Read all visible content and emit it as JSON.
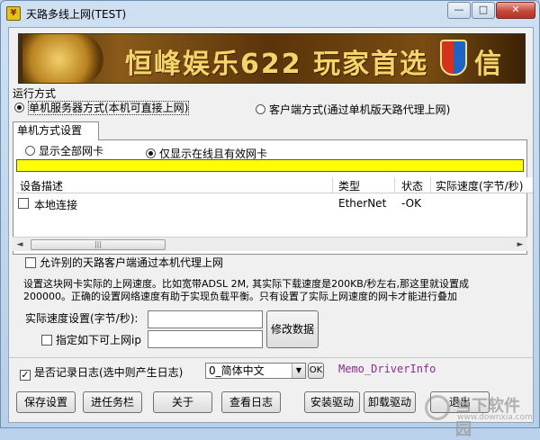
{
  "window": {
    "title": "天路多线上网(TEST)",
    "controls": {
      "minimize": "—",
      "maximize": "□",
      "close": "✕"
    }
  },
  "banner": {
    "text": "恒峰娱乐622 玩家首选",
    "text_right": "信誉"
  },
  "run_mode": {
    "label": "运行方式",
    "options": [
      {
        "label": "单机服务器方式(本机可直接上网)",
        "selected": true
      },
      {
        "label": "客户端方式(通过单机版天路代理上网)",
        "selected": false
      }
    ]
  },
  "tab": {
    "label": "单机方式设置"
  },
  "nic_filter": {
    "options": [
      {
        "label": "显示全部网卡",
        "selected": false
      },
      {
        "label": "仅显示在线且有效网卡",
        "selected": true
      }
    ]
  },
  "table": {
    "columns": [
      "设备描述",
      "类型",
      "状态",
      "实际速度(字节/秒)"
    ],
    "rows": [
      {
        "name": "本地连接",
        "type": "EtherNet",
        "status": "-OK",
        "speed": "",
        "checked": false
      }
    ]
  },
  "scrollbar": {
    "left": "◄",
    "right": "►",
    "grip": "|||"
  },
  "allow_proxy": {
    "label": "允许别的天路客户端通过本机代理上网",
    "checked": false
  },
  "notes": {
    "line1": "设置这块网卡实际的上网速度。比如宽带ADSL 2M, 其实际下载速度是200KB/秒左右,那这里就设置成",
    "line2": "200000。正确的设置网络速度有助于实现负载平衡。只有设置了实际上网速度的网卡才能进行叠加"
  },
  "speed_setting": {
    "label": "实际速度设置(字节/秒):",
    "value": ""
  },
  "specific_ip": {
    "label": "指定如下可上网ip",
    "checked": false,
    "value": ""
  },
  "modify_button": {
    "label": "修改数据"
  },
  "log": {
    "label": "是否记录日志(选中则产生日志)",
    "checked": true,
    "level_value": "0_简体中文",
    "dropdown_arrow": "▼",
    "ok_label": "OK",
    "memo": "Memo_DriverInfo"
  },
  "buttons": {
    "save": "保存设置",
    "tray": "进任务栏",
    "about": "关于",
    "view_log": "查看日志",
    "install_driver": "安装驱动",
    "uninstall_driver": "卸载驱动",
    "exit": "退出"
  },
  "watermark": {
    "text": "当下软件园",
    "sub": "www.downxia.com"
  }
}
